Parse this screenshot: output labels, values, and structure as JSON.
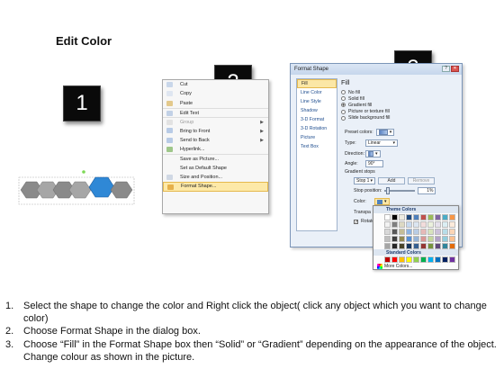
{
  "title": "Edit Color",
  "badges": [
    "1",
    "2",
    "3"
  ],
  "context_menu": {
    "items": [
      {
        "label": "Cut",
        "icon": "scissors-icon",
        "enabled": true,
        "submenu": false
      },
      {
        "label": "Copy",
        "icon": "copy-icon",
        "enabled": true,
        "submenu": false
      },
      {
        "label": "Paste",
        "icon": "paste-icon",
        "enabled": true,
        "submenu": false
      },
      {
        "label": "Edit Text",
        "icon": "edit-text-icon",
        "enabled": true,
        "submenu": false
      },
      {
        "label": "Group",
        "icon": "group-icon",
        "enabled": false,
        "submenu": true
      },
      {
        "label": "Bring to Front",
        "icon": "bring-front-icon",
        "enabled": true,
        "submenu": true
      },
      {
        "label": "Send to Back",
        "icon": "send-back-icon",
        "enabled": true,
        "submenu": true
      },
      {
        "label": "Hyperlink...",
        "icon": "hyperlink-icon",
        "enabled": true,
        "submenu": false
      },
      {
        "label": "Save as Picture...",
        "icon": "",
        "enabled": true,
        "submenu": false
      },
      {
        "label": "Set as Default Shape",
        "icon": "",
        "enabled": true,
        "submenu": false
      },
      {
        "label": "Size and Position...",
        "icon": "size-icon",
        "enabled": true,
        "submenu": false
      },
      {
        "label": "Format Shape...",
        "icon": "format-shape-icon",
        "enabled": true,
        "submenu": false,
        "active": true
      }
    ]
  },
  "dialog": {
    "title": "Format Shape",
    "nav": [
      "Fill",
      "Line Color",
      "Line Style",
      "Shadow",
      "3-D Format",
      "3-D Rotation",
      "Picture",
      "Text Box"
    ],
    "pane_title": "Fill",
    "fill_options": [
      "No fill",
      "Solid fill",
      "Gradient fill",
      "Picture or texture fill",
      "Slide background fill"
    ],
    "selected_fill": "Gradient fill",
    "preset_label": "Preset colors:",
    "type_label": "Type:",
    "type_value": "Linear",
    "direction_label": "Direction:",
    "angle_label": "Angle:",
    "angle_value": "90°",
    "gradient_stops_label": "Gradient stops",
    "stop_value": "Stop 1",
    "add_label": "Add",
    "remove_label": "Remove",
    "stop_position_label": "Stop position:",
    "stop_position_value": "1%",
    "color_label": "Color:",
    "transparency_label": "Transpa",
    "rotate_label": "Rotate"
  },
  "color_picker": {
    "theme_header": "Theme Colors",
    "standard_header": "Standard Colors",
    "more_label": "More Colors...",
    "theme_rows": [
      [
        "#ffffff",
        "#000000",
        "#eeece1",
        "#1f497d",
        "#4f81bd",
        "#c0504d",
        "#9bbb59",
        "#8064a2",
        "#4bacc6",
        "#f79646"
      ],
      [
        "#f2f2f2",
        "#7f7f7f",
        "#ddd9c3",
        "#c6d9f0",
        "#dbe5f1",
        "#f2dcdb",
        "#ebf1dd",
        "#e5e0ec",
        "#dbeef3",
        "#fdeada"
      ],
      [
        "#d8d8d8",
        "#595959",
        "#c4bd97",
        "#8db3e2",
        "#b8cce4",
        "#e5b9b7",
        "#d7e3bc",
        "#ccc1d9",
        "#b7dde8",
        "#fbd5b5"
      ],
      [
        "#bfbfbf",
        "#3f3f3f",
        "#938953",
        "#548dd4",
        "#95b3d7",
        "#d99694",
        "#c3d69b",
        "#b2a2c7",
        "#92cddc",
        "#fac08f"
      ],
      [
        "#a5a5a5",
        "#262626",
        "#494429",
        "#17365d",
        "#366092",
        "#953734",
        "#76923c",
        "#5f497a",
        "#31859b",
        "#e36c09"
      ]
    ],
    "standard_row": [
      "#c00000",
      "#ff0000",
      "#ffc000",
      "#ffff00",
      "#92d050",
      "#00b050",
      "#00b0f0",
      "#0070c0",
      "#002060",
      "#7030a0"
    ]
  },
  "instructions": [
    {
      "num": "1.",
      "text": "Select the shape to change the color and Right click the object( click any object which you want to change color)"
    },
    {
      "num": "2.",
      "text": "Choose Format Shape in the dialog box."
    },
    {
      "num": "3.",
      "text": "Choose “Fill” in the Format Shape box then “Solid” or “Gradient” depending on the appearance of the object. Change colour as shown in the picture."
    }
  ]
}
